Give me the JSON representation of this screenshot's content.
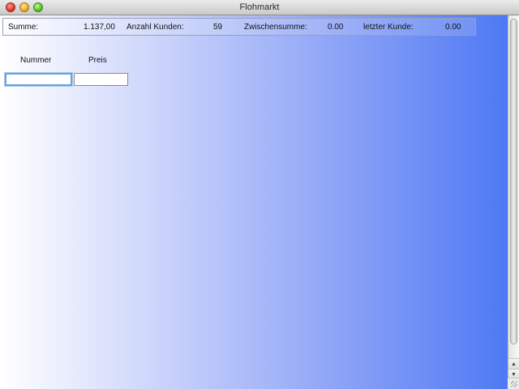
{
  "window": {
    "title": "Flohmarkt"
  },
  "summary": {
    "total_label": "Summe:",
    "total_value": "1.137,00",
    "customers_label": "Anzahl Kunden:",
    "customers_value": "59",
    "subtotal_label": "Zwischensumme:",
    "subtotal_value": "0.00",
    "last_customer_label": "letzter Kunde:",
    "last_customer_value": "0.00"
  },
  "entry": {
    "number_label": "Nummer",
    "price_label": "Preis",
    "number_value": "",
    "price_value": ""
  }
}
